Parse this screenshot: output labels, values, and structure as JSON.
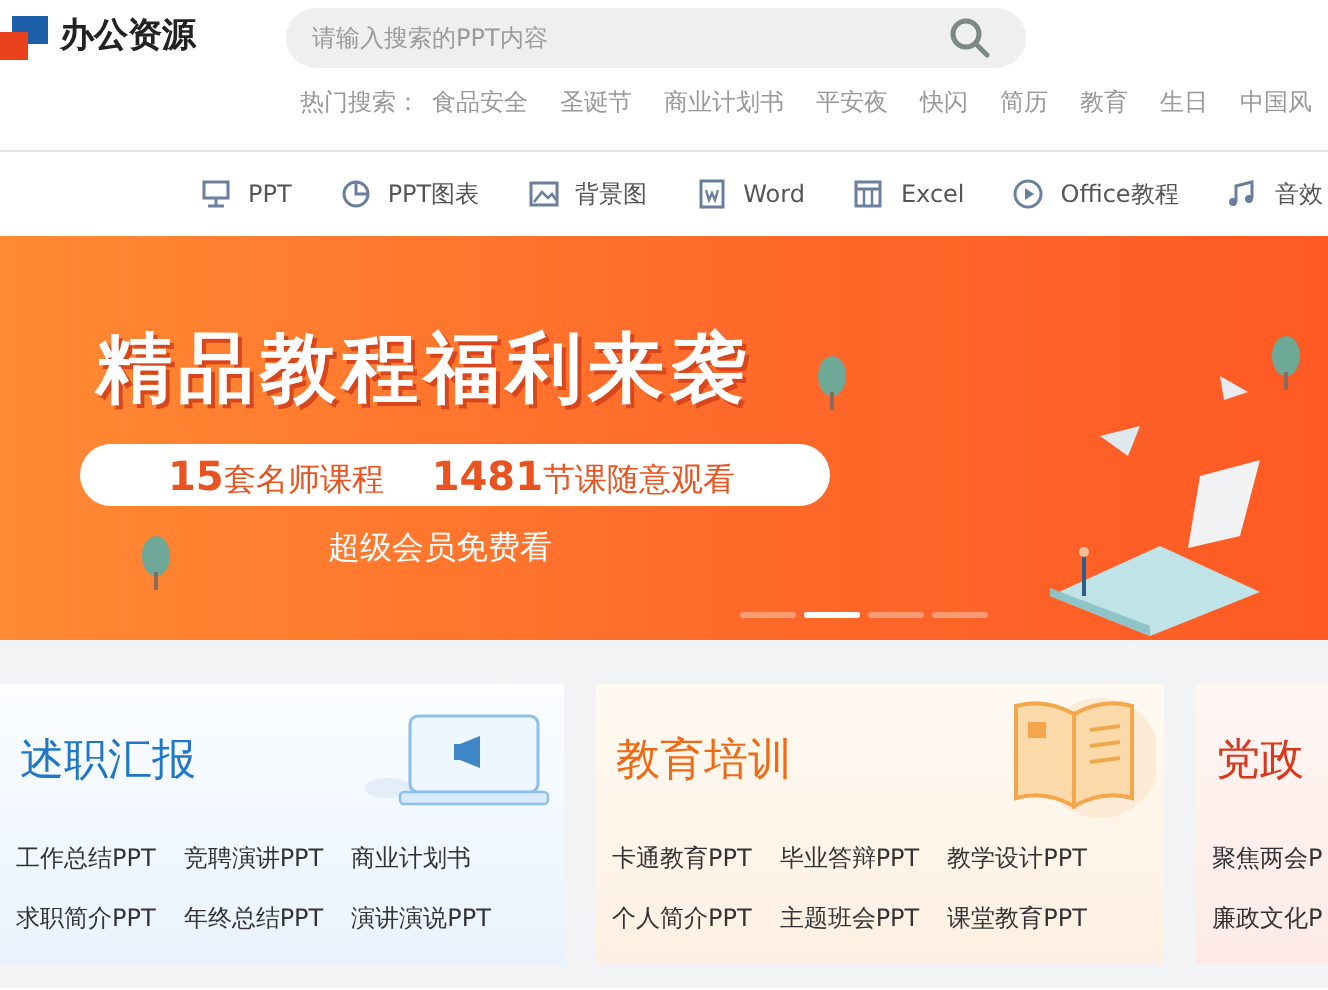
{
  "logo": {
    "text": "办公资源"
  },
  "search": {
    "placeholder": "请输入搜索的PPT内容"
  },
  "hot_search": {
    "label": "热门搜索：",
    "items": [
      "食品安全",
      "圣诞节",
      "商业计划书",
      "平安夜",
      "快闪",
      "简历",
      "教育",
      "生日",
      "中国风"
    ]
  },
  "nav": [
    {
      "label": "PPT"
    },
    {
      "label": "PPT图表"
    },
    {
      "label": "背景图"
    },
    {
      "label": "Word"
    },
    {
      "label": "Excel"
    },
    {
      "label": "Office教程"
    },
    {
      "label": "音效"
    }
  ],
  "banner": {
    "title": "精品教程福利来袭",
    "pill": [
      "**15**套名师课程",
      "**1481**节课随意观看"
    ],
    "subtitle": "超级会员免费看",
    "dots": [
      {
        "selected": false
      },
      {
        "selected": true
      },
      {
        "selected": false
      },
      {
        "selected": false
      }
    ]
  },
  "categories": [
    {
      "kind": "report",
      "title": "述职汇报",
      "links": [
        "工作总结PPT",
        "竞聘演讲PPT",
        "商业计划书",
        "求职简介PPT",
        "年终总结PPT",
        "演讲演说PPT"
      ]
    },
    {
      "kind": "education",
      "title": "教育培训",
      "links": [
        "卡通教育PPT",
        "毕业答辩PPT",
        "教学设计PPT",
        "个人简介PPT",
        "主题班会PPT",
        "课堂教育PPT"
      ]
    },
    {
      "kind": "party",
      "title": "党政",
      "links": [
        "聚焦两会P",
        "廉政文化P"
      ]
    }
  ]
}
